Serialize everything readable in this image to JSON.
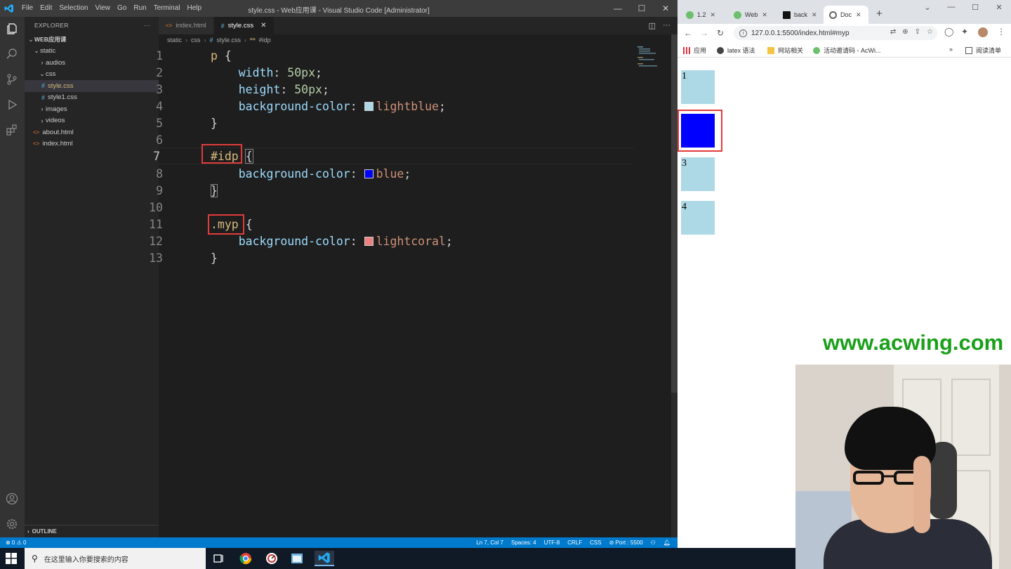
{
  "vscode": {
    "menu": [
      "File",
      "Edit",
      "Selection",
      "View",
      "Go",
      "Run",
      "Terminal",
      "Help"
    ],
    "window_title": "style.css - Web应用课 - Visual Studio Code [Administrator]",
    "explorer_label": "EXPLORER",
    "explorer_more": "···",
    "project": "WEB应用课",
    "tree": {
      "static": "static",
      "audios": "audios",
      "css": "css",
      "style_css": "style.css",
      "style1_css": "style1.css",
      "images": "images",
      "videos": "videos",
      "about_html": "about.html",
      "index_html": "index.html"
    },
    "outline": "OUTLINE",
    "tabs": [
      {
        "label": "index.html",
        "type": "html"
      },
      {
        "label": "style.css",
        "type": "css",
        "active": true
      }
    ],
    "breadcrumb": [
      "static",
      "css",
      "style.css",
      "#idp"
    ],
    "code": {
      "l1": "p",
      "l1b": " {",
      "l2p": "width",
      "l2v": "50px",
      "l3p": "height",
      "l3v": "50px",
      "l4p": "background-color",
      "l4v": "lightblue",
      "l5": "}",
      "l7": "#idp",
      "l7b": "{",
      "l8p": "background-color",
      "l8v": "blue",
      "l9": "}",
      "l11": ".myp",
      "l11b": "{",
      "l12p": "background-color",
      "l12v": "lightcoral",
      "l13": "}"
    },
    "line_numbers": [
      "1",
      "2",
      "3",
      "4",
      "5",
      "6",
      "7",
      "8",
      "9",
      "10",
      "11",
      "12",
      "13"
    ],
    "active_line": 7,
    "status": {
      "problems": "⊗ 0 ⚠ 0",
      "position": "Ln 7, Col 7",
      "spaces": "Spaces: 4",
      "encoding": "UTF-8",
      "eol": "CRLF",
      "language": "CSS",
      "port": "⊘ Port : 5500"
    }
  },
  "browser": {
    "tabs": [
      {
        "label": "1.2",
        "color": "#6cbf6c"
      },
      {
        "label": "Web",
        "color": "#6cbf6c"
      },
      {
        "label": "back",
        "color": "#111111"
      },
      {
        "label": "Doc",
        "color": "#777777",
        "active": true
      }
    ],
    "url": "127.0.0.1:5500/index.html#myp",
    "bookmarks": {
      "apps": "应用",
      "latex": "latex 语法",
      "site": "网站相关",
      "invite": "活动邀请码 - AcWi...",
      "reading": "阅读清单",
      "more": "»"
    },
    "boxes": [
      "1",
      "",
      "3",
      "4"
    ]
  },
  "watermark": "www.acwing.com",
  "taskbar": {
    "search_placeholder": "在这里输入你要搜索的内容"
  },
  "colors": {
    "lightblue": "#add8e6",
    "blue": "#0000ff",
    "lightcoral": "#f08080",
    "highlight_red": "#e23b3b",
    "statusbar": "#007acc"
  }
}
